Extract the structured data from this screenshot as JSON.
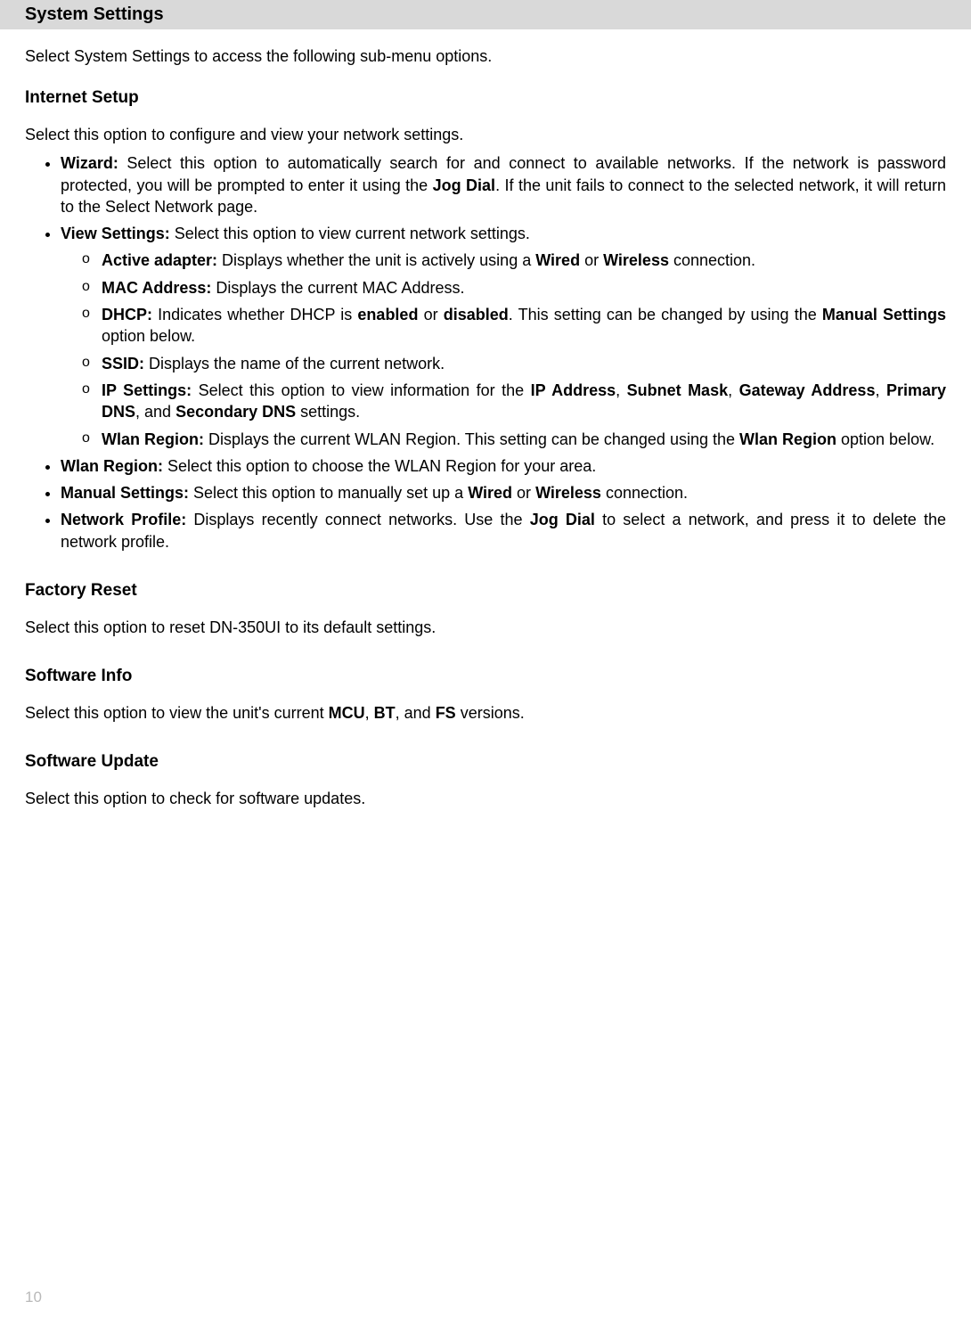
{
  "header": "System Settings",
  "intro": "Select System Settings to access the following sub-menu options.",
  "internet": {
    "heading": "Internet Setup",
    "desc": "Select this option to configure and view your network settings.",
    "wizard": {
      "label": "Wizard:",
      "text": " Select this option to automatically search for and connect to available networks. If the network is password protected, you will be prompted to enter it using the ",
      "jog": "Jog Dial",
      "text2": ". If the unit fails to connect to the selected network, it will return to the Select Network page."
    },
    "view": {
      "label": "View Settings:",
      "text": " Select this option to view current network settings.",
      "sub": {
        "active": {
          "label": "Active adapter:",
          "t1": " Displays whether the unit is actively using a ",
          "b1": "Wired",
          "t2": " or ",
          "b2": "Wireless",
          "t3": " connection."
        },
        "mac": {
          "label": "MAC Address:",
          "t1": " Displays the current MAC Address."
        },
        "dhcp": {
          "label": "DHCP:",
          "t1": " Indicates whether DHCP is ",
          "b1": "enabled",
          "t2": " or ",
          "b2": "disabled",
          "t3": ". This setting can be changed by using the ",
          "b3": "Manual Settings",
          "t4": " option below."
        },
        "ssid": {
          "label": "SSID:",
          "t1": " Displays the name of the current network."
        },
        "ip": {
          "label": "IP Settings:",
          "t1": " Select this option to view information for the ",
          "b1": "IP Address",
          "t2": ", ",
          "b2": "Subnet Mask",
          "t3": ", ",
          "b3": "Gateway Address",
          "t4": ", ",
          "b4": "Primary DNS",
          "t5": ", and ",
          "b5": "Secondary DNS",
          "t6": " settings."
        },
        "wlan": {
          "label": "Wlan Region:",
          "t1": " Displays the current WLAN Region. This setting can be changed using the ",
          "b1": "Wlan Region",
          "t2": " option below."
        }
      }
    },
    "wlanRegion": {
      "label": "Wlan Region:",
      "t1": " Select this option to choose the WLAN Region for your area."
    },
    "manual": {
      "label": "Manual Settings:",
      "t1": " Select this option to manually set up a ",
      "b1": "Wired",
      "t2": " or ",
      "b2": "Wireless",
      "t3": " connection."
    },
    "profile": {
      "label": "Network Profile:",
      "t1": " Displays recently connect networks. Use the ",
      "b1": "Jog Dial",
      "t2": " to select a network, and press it to delete the network profile."
    }
  },
  "factory": {
    "heading": "Factory Reset",
    "desc": "Select this option to reset DN-350UI to its default settings."
  },
  "swinfo": {
    "heading": "Software Info",
    "t1": "Select this option to view the unit's current ",
    "b1": "MCU",
    "t2": ", ",
    "b2": "BT",
    "t3": ", and ",
    "b3": "FS",
    "t4": " versions."
  },
  "swupdate": {
    "heading": "Software Update",
    "desc": "Select this option to check for software updates."
  },
  "pageNumber": "10"
}
